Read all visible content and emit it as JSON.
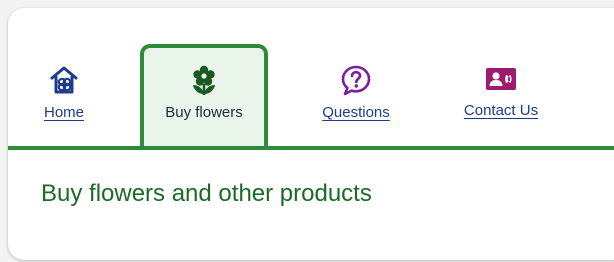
{
  "tabs": {
    "home": {
      "label": "Home",
      "icon": "home-icon"
    },
    "buy_flowers": {
      "label": "Buy flowers",
      "icon": "flower-icon",
      "active": true
    },
    "questions": {
      "label": "Questions",
      "icon": "question-icon"
    },
    "contact": {
      "label": "Contact Us",
      "icon": "contact-card-icon"
    }
  },
  "main": {
    "heading": "Buy flowers and other products"
  },
  "colors": {
    "accent_green": "#2e8b3a",
    "active_tab_bg": "#e9f4ea",
    "link_blue": "#1f3b8f",
    "contact_icon": "#9b1b6e",
    "heading_green": "#1a6b26"
  }
}
